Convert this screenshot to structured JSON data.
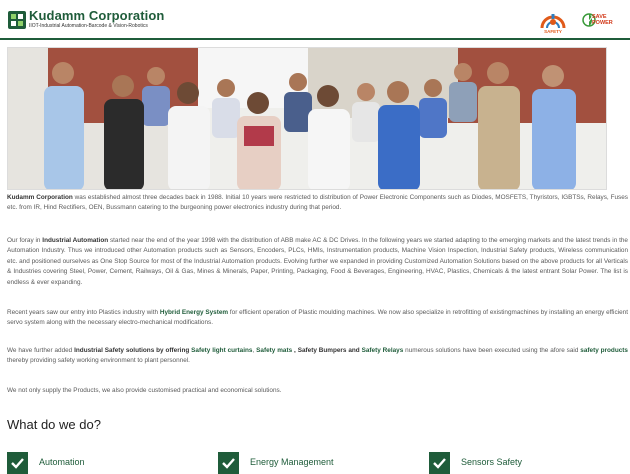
{
  "header": {
    "brand": "Kudamm Corporation",
    "tagline": "IIOT-Industrial Automation-Barcode & Vision-Robotics",
    "badges": {
      "safety": "SAFETY",
      "power_line1": "SAVE",
      "power_line2": "POWER"
    }
  },
  "intro": {
    "p1": {
      "lead": "Kudamm Corporation",
      "text": " was established almost three decades back in 1988. Initial 10 years were restricted to distribution of Power Electronic Components such as Diodes, MOSFETS, Thyristors, IGBTSs, Relays, Fuses etc. from IR, Hind Rectifiers, OEN, Bussmann catering to the burgeoning power electronics industry during that period."
    },
    "p2": {
      "before": "Our foray in ",
      "lead": "Industrial Automation",
      "text": " started near the end of the year 1998 with the distribution of ABB make AC & DC Drives. In the following years we started adapting to the emerging markets and the latest trends in the Automation Industry. Thus we introduced other Automation products such as Sensors, Encoders, PLCs, HMIs, Instrumentation products, Machine Vision Inspection, Industrial Safety products, Wireless communication etc. and positioned ourselves as One Stop Source for most of the Industrial Automation products. Evolving further we expanded in providing Customized Automation Solutions based on the above products for all Verticals & Industries covering Steel, Power, Cement, Railways, Oil & Gas, Mines & Minerals, Paper, Printing, Packaging, Food & Beverages, Engineering, HVAC, Plastics, Chemicals & the latest entrant Solar Power. The list is endless & ever expanding."
    },
    "p3": {
      "before": "Recent years saw our entry into Plastics industry with ",
      "link": "Hybrid Energy System",
      "after": " for efficient operation of Plastic moulding machines. We now also specialize in retrofitting of existingmachines by installing an energy efficient servo system along with the necessary electro-mechanical modifications."
    },
    "p4": {
      "before": "We have further added ",
      "lead": "Industrial Safety solutions by offering ",
      "link1": "Safety light curtains",
      "sep1": ", ",
      "link2": "Safety mats",
      "sep2": " , Safety Bumpers and ",
      "link3": "Safety Relays",
      "mid": " numerous solutions have been executed using the afore said ",
      "link4": "safety products",
      "after": " thereby providing safety working environment to plant personnel."
    },
    "p5": "We not only supply the Products, we also provide customised practical and economical solutions."
  },
  "services": {
    "title": "What do we do?",
    "items": [
      {
        "label": "Automation",
        "icon": "check-icon"
      },
      {
        "label": "Energy Management",
        "icon": "check-icon"
      },
      {
        "label": "Sensors Safety",
        "icon": "check-icon"
      }
    ]
  },
  "colors": {
    "brand_green": "#1f5c3a",
    "text_gray": "#5a5a5a",
    "safety_orange": "#e05a1a"
  }
}
